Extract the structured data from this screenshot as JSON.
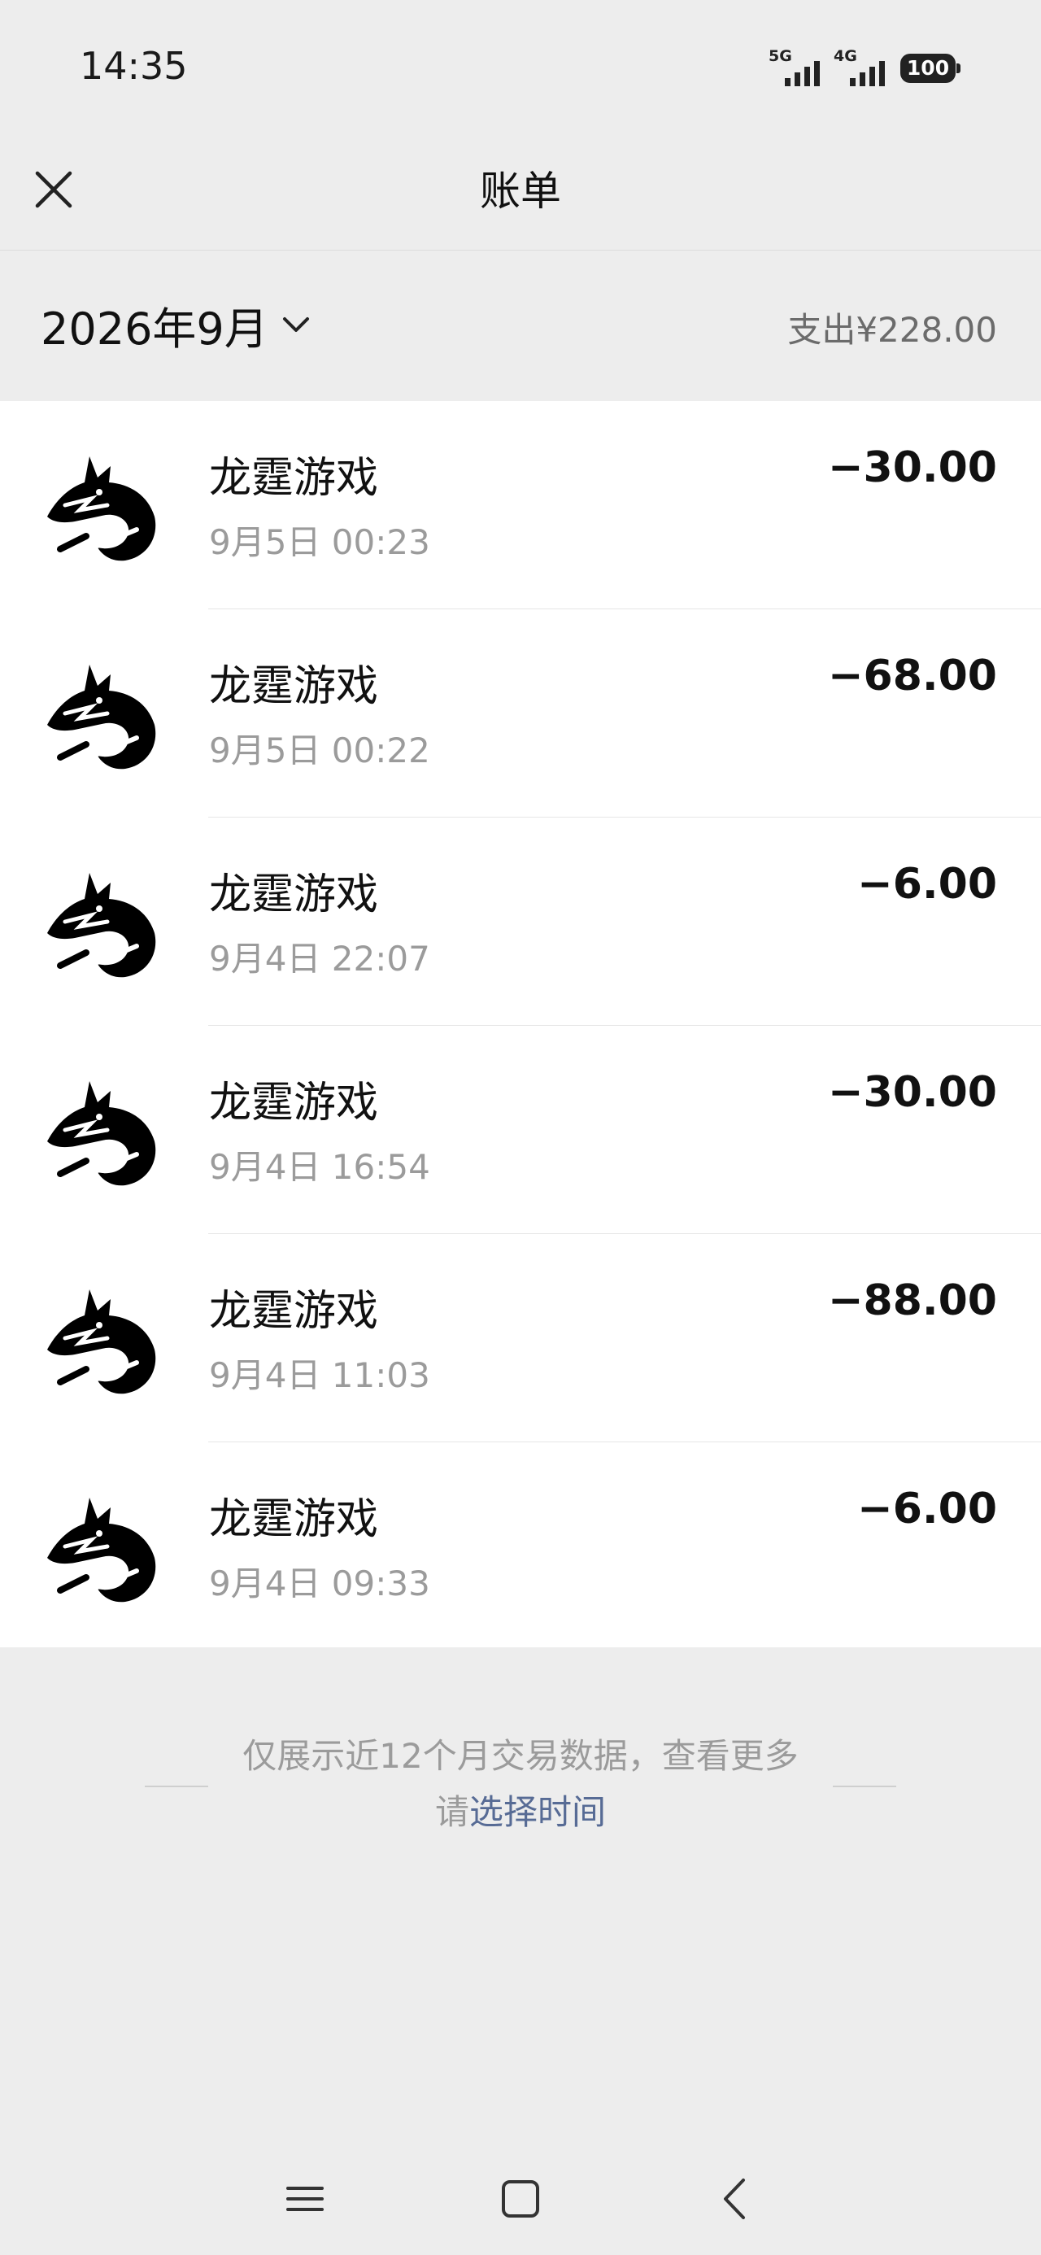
{
  "status_bar": {
    "time": "14:35",
    "network_1": "5G",
    "network_2": "4G",
    "battery": "100"
  },
  "header": {
    "title": "账单",
    "close_icon": "close-icon"
  },
  "summary": {
    "month": "2026年9月",
    "expense": "支出¥228.00"
  },
  "transactions": [
    {
      "merchant": "龙霆游戏",
      "date": "9月5日 00:23",
      "amount": "−30.00"
    },
    {
      "merchant": "龙霆游戏",
      "date": "9月5日 00:22",
      "amount": "−68.00"
    },
    {
      "merchant": "龙霆游戏",
      "date": "9月4日 22:07",
      "amount": "−6.00"
    },
    {
      "merchant": "龙霆游戏",
      "date": "9月4日 16:54",
      "amount": "−30.00"
    },
    {
      "merchant": "龙霆游戏",
      "date": "9月4日 11:03",
      "amount": "−88.00"
    },
    {
      "merchant": "龙霆游戏",
      "date": "9月4日 09:33",
      "amount": "−6.00"
    }
  ],
  "footer": {
    "note": "仅展示近12个月交易数据，查看更多",
    "prefix": "请",
    "link": "选择时间"
  },
  "colors": {
    "background": "#ededed",
    "link": "#576b95",
    "secondary_text": "#9b9b9b"
  }
}
